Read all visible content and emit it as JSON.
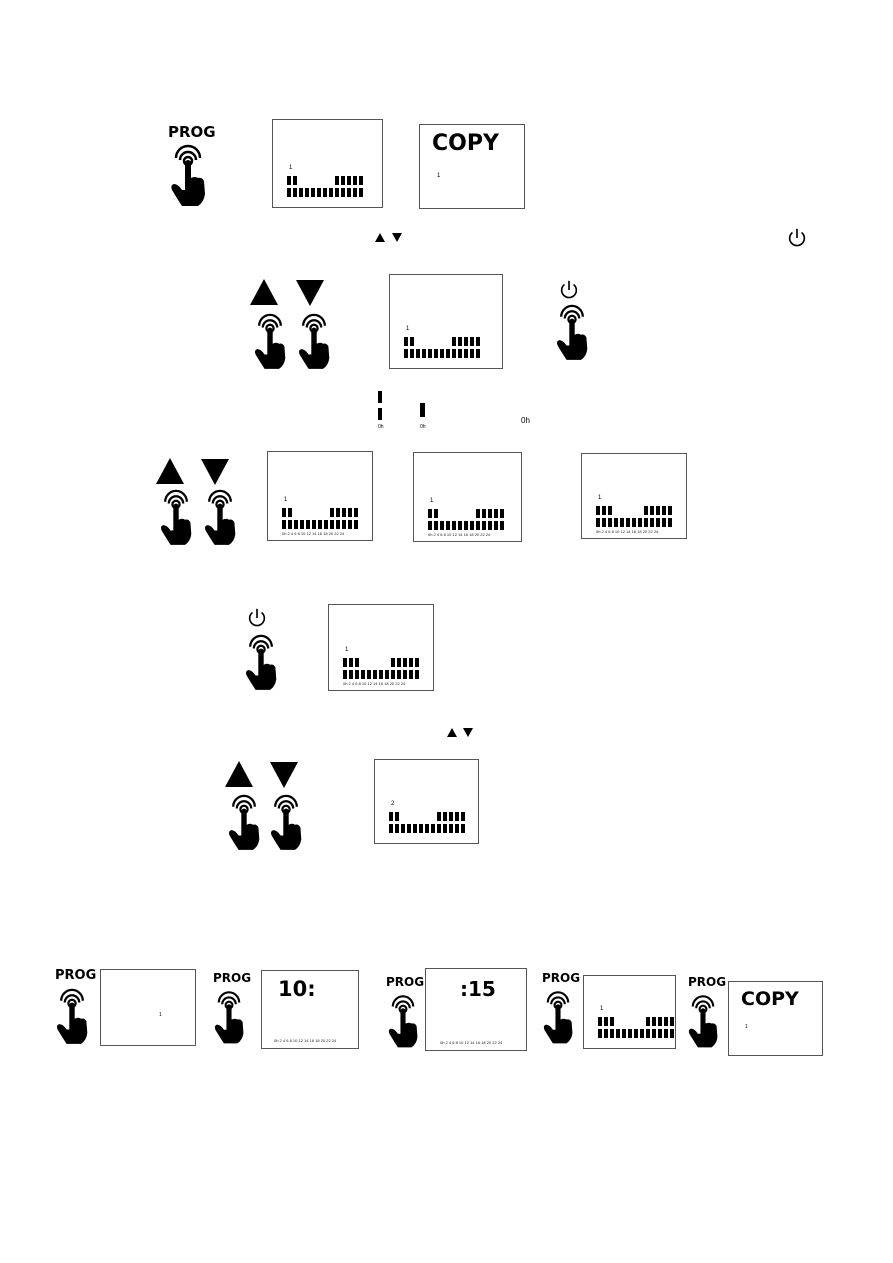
{
  "buttons": {
    "prog": "PROG"
  },
  "icons": {
    "press": "hand-press-icon",
    "up": "triangle-up-icon",
    "down": "triangle-down-icon",
    "power": "power-icon"
  },
  "lcd": {
    "copy": "COPY",
    "day1": "1",
    "day2": "2",
    "hours": "0h 2 4 6 8 10 12 14 16 18 20 22 24",
    "hour_label": "0h",
    "hour_value": "10:",
    "minute_value": ":15",
    "pattern_2left": [
      1,
      1,
      0,
      0,
      0,
      0,
      0,
      0,
      1,
      1,
      1,
      1,
      1
    ],
    "pattern_3left": [
      1,
      1,
      1,
      0,
      0,
      0,
      0,
      0,
      1,
      1,
      1,
      1,
      1
    ],
    "pattern_bottom": [
      1,
      1,
      1,
      1,
      1,
      1,
      1,
      1,
      1,
      1,
      1,
      1,
      1
    ]
  }
}
